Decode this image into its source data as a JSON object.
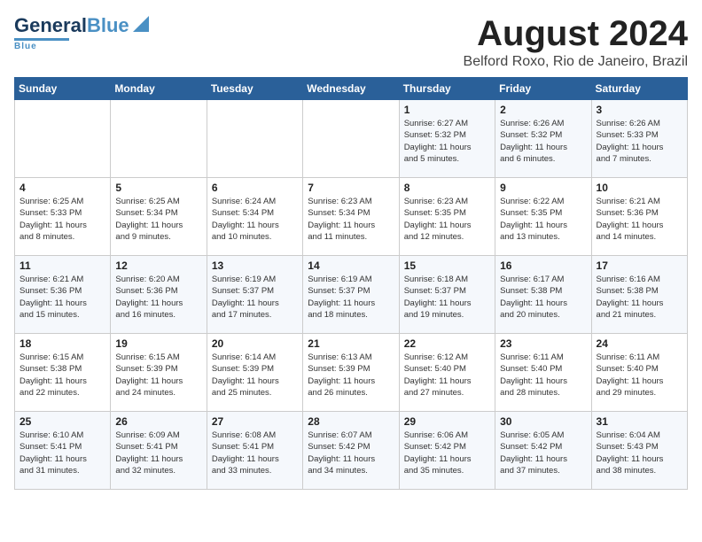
{
  "header": {
    "logo_general": "General",
    "logo_blue": "Blue",
    "month_title": "August 2024",
    "location": "Belford Roxo, Rio de Janeiro, Brazil"
  },
  "weekdays": [
    "Sunday",
    "Monday",
    "Tuesday",
    "Wednesday",
    "Thursday",
    "Friday",
    "Saturday"
  ],
  "weeks": [
    [
      {
        "day": "",
        "detail": ""
      },
      {
        "day": "",
        "detail": ""
      },
      {
        "day": "",
        "detail": ""
      },
      {
        "day": "",
        "detail": ""
      },
      {
        "day": "1",
        "detail": "Sunrise: 6:27 AM\nSunset: 5:32 PM\nDaylight: 11 hours\nand 5 minutes."
      },
      {
        "day": "2",
        "detail": "Sunrise: 6:26 AM\nSunset: 5:32 PM\nDaylight: 11 hours\nand 6 minutes."
      },
      {
        "day": "3",
        "detail": "Sunrise: 6:26 AM\nSunset: 5:33 PM\nDaylight: 11 hours\nand 7 minutes."
      }
    ],
    [
      {
        "day": "4",
        "detail": "Sunrise: 6:25 AM\nSunset: 5:33 PM\nDaylight: 11 hours\nand 8 minutes."
      },
      {
        "day": "5",
        "detail": "Sunrise: 6:25 AM\nSunset: 5:34 PM\nDaylight: 11 hours\nand 9 minutes."
      },
      {
        "day": "6",
        "detail": "Sunrise: 6:24 AM\nSunset: 5:34 PM\nDaylight: 11 hours\nand 10 minutes."
      },
      {
        "day": "7",
        "detail": "Sunrise: 6:23 AM\nSunset: 5:34 PM\nDaylight: 11 hours\nand 11 minutes."
      },
      {
        "day": "8",
        "detail": "Sunrise: 6:23 AM\nSunset: 5:35 PM\nDaylight: 11 hours\nand 12 minutes."
      },
      {
        "day": "9",
        "detail": "Sunrise: 6:22 AM\nSunset: 5:35 PM\nDaylight: 11 hours\nand 13 minutes."
      },
      {
        "day": "10",
        "detail": "Sunrise: 6:21 AM\nSunset: 5:36 PM\nDaylight: 11 hours\nand 14 minutes."
      }
    ],
    [
      {
        "day": "11",
        "detail": "Sunrise: 6:21 AM\nSunset: 5:36 PM\nDaylight: 11 hours\nand 15 minutes."
      },
      {
        "day": "12",
        "detail": "Sunrise: 6:20 AM\nSunset: 5:36 PM\nDaylight: 11 hours\nand 16 minutes."
      },
      {
        "day": "13",
        "detail": "Sunrise: 6:19 AM\nSunset: 5:37 PM\nDaylight: 11 hours\nand 17 minutes."
      },
      {
        "day": "14",
        "detail": "Sunrise: 6:19 AM\nSunset: 5:37 PM\nDaylight: 11 hours\nand 18 minutes."
      },
      {
        "day": "15",
        "detail": "Sunrise: 6:18 AM\nSunset: 5:37 PM\nDaylight: 11 hours\nand 19 minutes."
      },
      {
        "day": "16",
        "detail": "Sunrise: 6:17 AM\nSunset: 5:38 PM\nDaylight: 11 hours\nand 20 minutes."
      },
      {
        "day": "17",
        "detail": "Sunrise: 6:16 AM\nSunset: 5:38 PM\nDaylight: 11 hours\nand 21 minutes."
      }
    ],
    [
      {
        "day": "18",
        "detail": "Sunrise: 6:15 AM\nSunset: 5:38 PM\nDaylight: 11 hours\nand 22 minutes."
      },
      {
        "day": "19",
        "detail": "Sunrise: 6:15 AM\nSunset: 5:39 PM\nDaylight: 11 hours\nand 24 minutes."
      },
      {
        "day": "20",
        "detail": "Sunrise: 6:14 AM\nSunset: 5:39 PM\nDaylight: 11 hours\nand 25 minutes."
      },
      {
        "day": "21",
        "detail": "Sunrise: 6:13 AM\nSunset: 5:39 PM\nDaylight: 11 hours\nand 26 minutes."
      },
      {
        "day": "22",
        "detail": "Sunrise: 6:12 AM\nSunset: 5:40 PM\nDaylight: 11 hours\nand 27 minutes."
      },
      {
        "day": "23",
        "detail": "Sunrise: 6:11 AM\nSunset: 5:40 PM\nDaylight: 11 hours\nand 28 minutes."
      },
      {
        "day": "24",
        "detail": "Sunrise: 6:11 AM\nSunset: 5:40 PM\nDaylight: 11 hours\nand 29 minutes."
      }
    ],
    [
      {
        "day": "25",
        "detail": "Sunrise: 6:10 AM\nSunset: 5:41 PM\nDaylight: 11 hours\nand 31 minutes."
      },
      {
        "day": "26",
        "detail": "Sunrise: 6:09 AM\nSunset: 5:41 PM\nDaylight: 11 hours\nand 32 minutes."
      },
      {
        "day": "27",
        "detail": "Sunrise: 6:08 AM\nSunset: 5:41 PM\nDaylight: 11 hours\nand 33 minutes."
      },
      {
        "day": "28",
        "detail": "Sunrise: 6:07 AM\nSunset: 5:42 PM\nDaylight: 11 hours\nand 34 minutes."
      },
      {
        "day": "29",
        "detail": "Sunrise: 6:06 AM\nSunset: 5:42 PM\nDaylight: 11 hours\nand 35 minutes."
      },
      {
        "day": "30",
        "detail": "Sunrise: 6:05 AM\nSunset: 5:42 PM\nDaylight: 11 hours\nand 37 minutes."
      },
      {
        "day": "31",
        "detail": "Sunrise: 6:04 AM\nSunset: 5:43 PM\nDaylight: 11 hours\nand 38 minutes."
      }
    ]
  ]
}
